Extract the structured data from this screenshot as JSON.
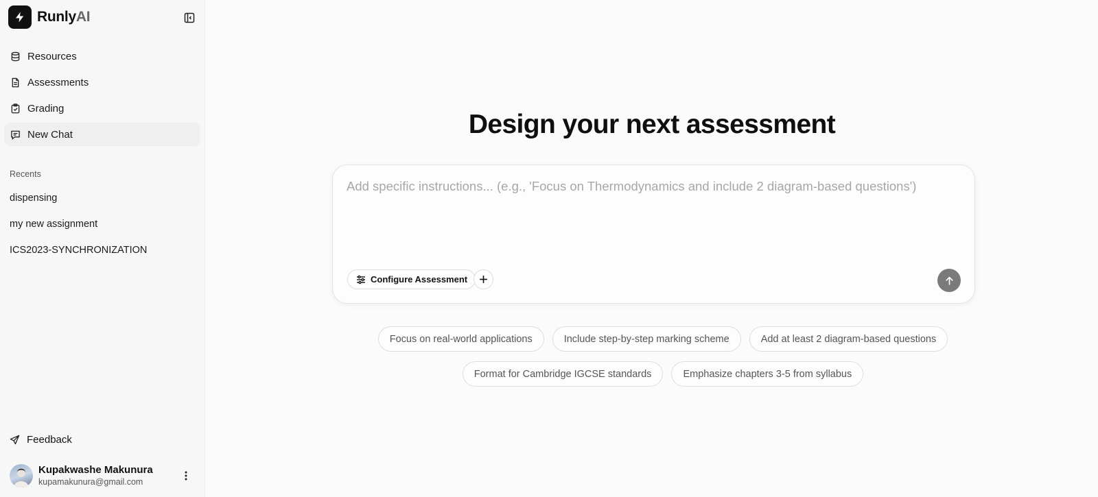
{
  "brand": {
    "name_main": "Runly",
    "name_suffix": "AI"
  },
  "sidebar": {
    "nav": [
      {
        "label": "Resources",
        "icon": "database-icon"
      },
      {
        "label": "Assessments",
        "icon": "file-text-icon"
      },
      {
        "label": "Grading",
        "icon": "clipboard-check-icon"
      },
      {
        "label": "New Chat",
        "icon": "message-plus-icon",
        "active": true
      }
    ],
    "recents_label": "Recents",
    "recents": [
      "dispensing",
      "my new assignment",
      "ICS2023-SYNCHRONIZATION"
    ],
    "feedback_label": "Feedback",
    "user": {
      "name": "Kupakwashe Makunura",
      "email": "kupamakunura@gmail.com"
    }
  },
  "main": {
    "title": "Design your next assessment",
    "composer": {
      "placeholder": "Add specific instructions... (e.g., 'Focus on Thermodynamics and include 2 diagram-based questions')",
      "value": "",
      "config_label": "Configure Assessment"
    },
    "suggestions_row1": [
      "Focus on real-world applications",
      "Include step-by-step marking scheme",
      "Add at least 2 diagram-based questions"
    ],
    "suggestions_row2": [
      "Format for Cambridge IGCSE standards",
      "Emphasize chapters 3-5 from syllabus"
    ]
  },
  "colors": {
    "accent": "#111111",
    "send_button": "#7a7a7a",
    "active_nav_bg": "#efefef"
  }
}
